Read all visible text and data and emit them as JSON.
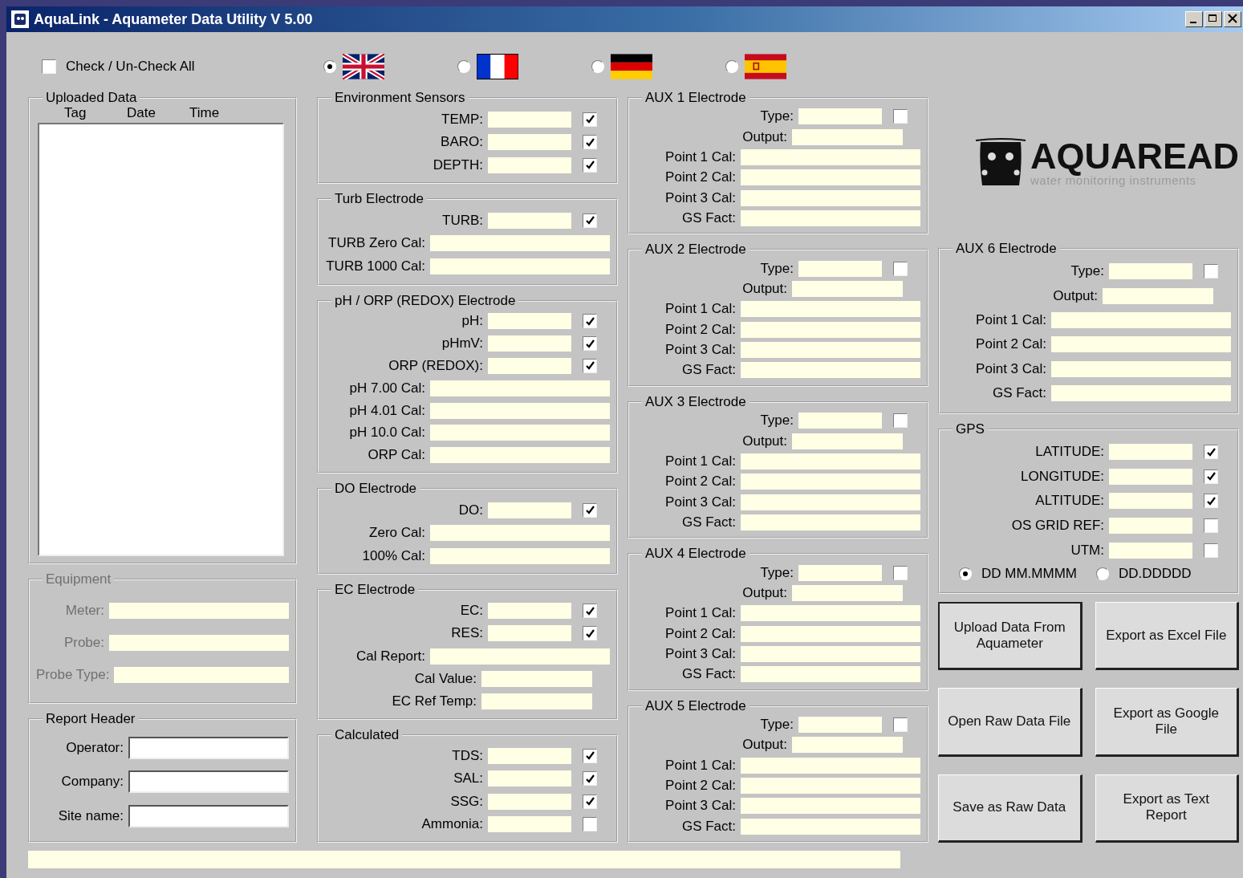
{
  "window": {
    "title": "AquaLink - Aquameter Data Utility V 5.00"
  },
  "check_all": {
    "label": "Check / Un-Check All",
    "checked": false
  },
  "languages": [
    {
      "kind": "uk",
      "selected": true
    },
    {
      "kind": "france",
      "selected": false
    },
    {
      "kind": "germany",
      "selected": false
    },
    {
      "kind": "spain",
      "selected": false
    }
  ],
  "uploaded_data": {
    "title": "Uploaded Data",
    "columns": [
      "Tag",
      "Date",
      "Time"
    ]
  },
  "equipment": {
    "title": "Equipment",
    "disabled": true,
    "rows": [
      {
        "label": "Meter:",
        "kind": "wide"
      },
      {
        "label": "Probe:",
        "kind": "wide"
      },
      {
        "label": "Probe Type:",
        "kind": "wide"
      }
    ]
  },
  "report_header": {
    "title": "Report Header",
    "rows": [
      {
        "label": "Operator:",
        "kind": "entry"
      },
      {
        "label": "Company:",
        "kind": "entry"
      },
      {
        "label": "Site name:",
        "kind": "entry"
      }
    ]
  },
  "sensor_groups": [
    {
      "title": "Environment Sensors",
      "rows": [
        {
          "label": "TEMP:",
          "kind": "check",
          "checked": true
        },
        {
          "label": "BARO:",
          "kind": "check",
          "checked": true
        },
        {
          "label": "DEPTH:",
          "kind": "check",
          "checked": true
        }
      ]
    },
    {
      "title": "Turb Electrode",
      "rows": [
        {
          "label": "TURB:",
          "kind": "check",
          "checked": true
        },
        {
          "label": "TURB Zero Cal:",
          "kind": "wide"
        },
        {
          "label": "TURB 1000 Cal:",
          "kind": "wide"
        }
      ]
    },
    {
      "title": "pH / ORP (REDOX) Electrode",
      "rows": [
        {
          "label": "pH:",
          "kind": "check",
          "checked": true
        },
        {
          "label": "pHmV:",
          "kind": "check",
          "checked": true
        },
        {
          "label": "ORP (REDOX):",
          "kind": "check",
          "checked": true
        },
        {
          "label": "pH 7.00 Cal:",
          "kind": "wide"
        },
        {
          "label": "pH 4.01 Cal:",
          "kind": "wide"
        },
        {
          "label": "pH 10.0 Cal:",
          "kind": "wide"
        },
        {
          "label": "ORP Cal:",
          "kind": "wide"
        }
      ]
    },
    {
      "title": "DO Electrode",
      "rows": [
        {
          "label": "DO:",
          "kind": "check",
          "checked": true
        },
        {
          "label": "Zero Cal:",
          "kind": "wide"
        },
        {
          "label": "100% Cal:",
          "kind": "wide"
        }
      ]
    },
    {
      "title": "EC Electrode",
      "rows": [
        {
          "label": "EC:",
          "kind": "check",
          "checked": true
        },
        {
          "label": "RES:",
          "kind": "check",
          "checked": true
        },
        {
          "label": "Cal Report:",
          "kind": "wide"
        },
        {
          "label": "Cal Value:",
          "kind": "short"
        },
        {
          "label": "EC Ref Temp:",
          "kind": "short"
        }
      ]
    },
    {
      "title": "Calculated",
      "rows": [
        {
          "label": "TDS:",
          "kind": "check",
          "checked": true
        },
        {
          "label": "SAL:",
          "kind": "check",
          "checked": true
        },
        {
          "label": "SSG:",
          "kind": "check",
          "checked": true
        },
        {
          "label": "Ammonia:",
          "kind": "check",
          "checked": false
        }
      ]
    }
  ],
  "aux_groups": [
    {
      "title": "AUX 1 Electrode",
      "rows": [
        {
          "label": "Type:",
          "kind": "check",
          "checked": false
        },
        {
          "label": "Output:",
          "kind": "short"
        },
        {
          "label": "Point 1 Cal:",
          "kind": "wide"
        },
        {
          "label": "Point 2 Cal:",
          "kind": "wide"
        },
        {
          "label": "Point 3 Cal:",
          "kind": "wide"
        },
        {
          "label": "GS Fact:",
          "kind": "wide"
        }
      ]
    },
    {
      "title": "AUX 2 Electrode",
      "rows": [
        {
          "label": "Type:",
          "kind": "check",
          "checked": false
        },
        {
          "label": "Output:",
          "kind": "short"
        },
        {
          "label": "Point 1 Cal:",
          "kind": "wide"
        },
        {
          "label": "Point 2 Cal:",
          "kind": "wide"
        },
        {
          "label": "Point 3 Cal:",
          "kind": "wide"
        },
        {
          "label": "GS Fact:",
          "kind": "wide"
        }
      ]
    },
    {
      "title": "AUX 3 Electrode",
      "rows": [
        {
          "label": "Type:",
          "kind": "check",
          "checked": false
        },
        {
          "label": "Output:",
          "kind": "short"
        },
        {
          "label": "Point 1 Cal:",
          "kind": "wide"
        },
        {
          "label": "Point 2 Cal:",
          "kind": "wide"
        },
        {
          "label": "Point 3 Cal:",
          "kind": "wide"
        },
        {
          "label": "GS Fact:",
          "kind": "wide"
        }
      ]
    },
    {
      "title": "AUX 4 Electrode",
      "rows": [
        {
          "label": "Type:",
          "kind": "check",
          "checked": false
        },
        {
          "label": "Output:",
          "kind": "short"
        },
        {
          "label": "Point 1 Cal:",
          "kind": "wide"
        },
        {
          "label": "Point 2 Cal:",
          "kind": "wide"
        },
        {
          "label": "Point 3 Cal:",
          "kind": "wide"
        },
        {
          "label": "GS Fact:",
          "kind": "wide"
        }
      ]
    },
    {
      "title": "AUX 5 Electrode",
      "rows": [
        {
          "label": "Type:",
          "kind": "check",
          "checked": false
        },
        {
          "label": "Output:",
          "kind": "short"
        },
        {
          "label": "Point 1 Cal:",
          "kind": "wide"
        },
        {
          "label": "Point 2 Cal:",
          "kind": "wide"
        },
        {
          "label": "Point 3 Cal:",
          "kind": "wide"
        },
        {
          "label": "GS Fact:",
          "kind": "wide"
        }
      ]
    }
  ],
  "logo": {
    "name": "AQUAREAD",
    "tagline": "water monitoring instruments"
  },
  "aux6": {
    "title": "AUX 6 Electrode",
    "rows": [
      {
        "label": "Type:",
        "kind": "check",
        "checked": false
      },
      {
        "label": "Output:",
        "kind": "short"
      },
      {
        "label": "Point 1 Cal:",
        "kind": "wide"
      },
      {
        "label": "Point 2 Cal:",
        "kind": "wide"
      },
      {
        "label": "Point 3 Cal:",
        "kind": "wide"
      },
      {
        "label": "GS Fact:",
        "kind": "wide"
      }
    ]
  },
  "gps": {
    "title": "GPS",
    "rows": [
      {
        "label": "LATITUDE:",
        "kind": "check",
        "checked": true
      },
      {
        "label": "LONGITUDE:",
        "kind": "check",
        "checked": true
      },
      {
        "label": "ALTITUDE:",
        "kind": "check",
        "checked": true
      },
      {
        "label": "OS GRID REF:",
        "kind": "check",
        "checked": false
      },
      {
        "label": "UTM:",
        "kind": "check",
        "checked": false
      }
    ],
    "formats": [
      {
        "label": "DD MM.MMMM",
        "selected": true
      },
      {
        "label": "DD.DDDDD",
        "selected": false
      }
    ]
  },
  "buttons": [
    {
      "label": "Upload Data From Aquameter",
      "focused": true
    },
    {
      "label": "Export as Excel File",
      "focused": false
    },
    {
      "label": "Open Raw Data File",
      "focused": false
    },
    {
      "label": "Export as Google File",
      "focused": false
    },
    {
      "label": "Save as Raw Data",
      "focused": false
    },
    {
      "label": "Export as Text Report",
      "focused": false
    }
  ]
}
